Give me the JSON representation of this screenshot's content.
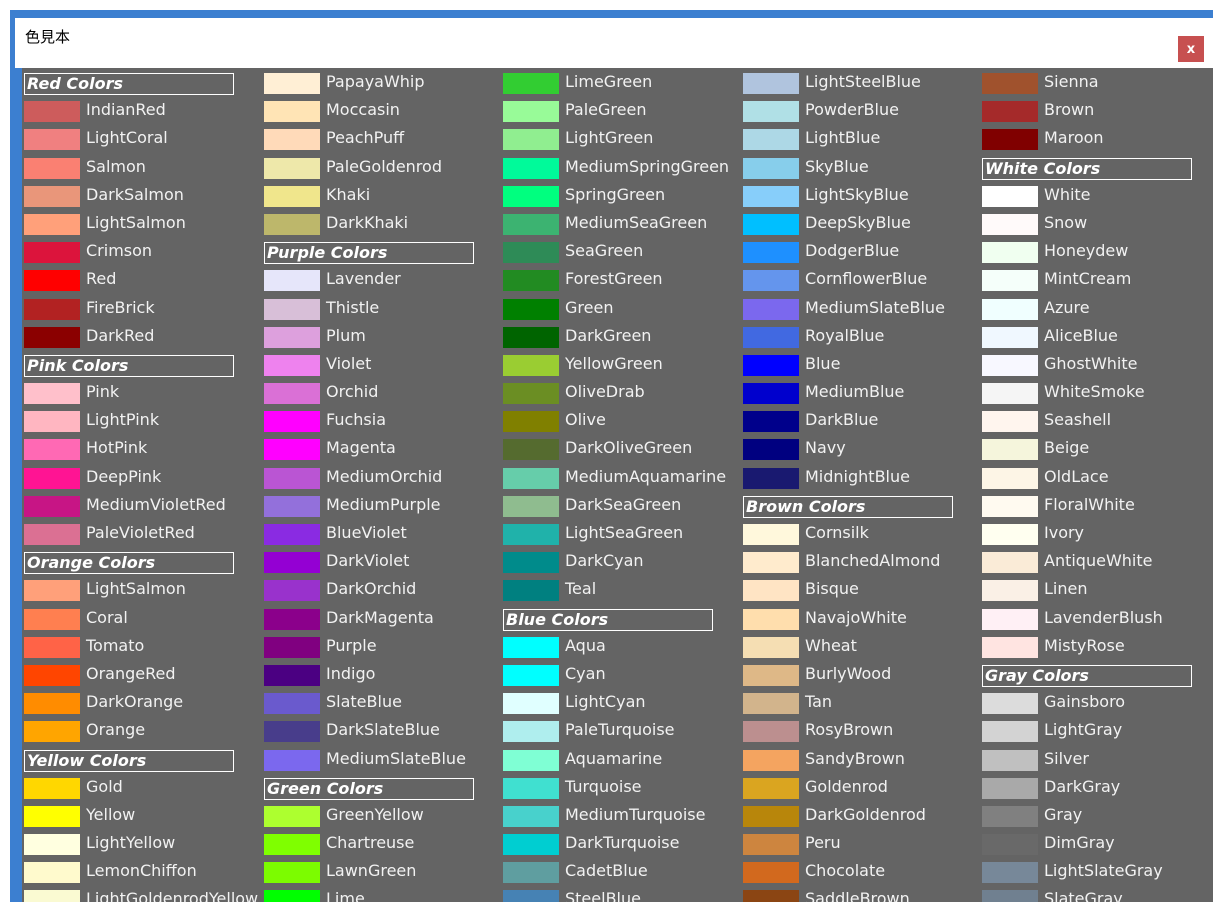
{
  "window": {
    "title": "色見本",
    "close_label": "x"
  },
  "columns": [
    [
      {
        "header": "Red Colors"
      },
      {
        "name": "IndianRed",
        "color": "#CD5C5C"
      },
      {
        "name": "LightCoral",
        "color": "#F08080"
      },
      {
        "name": "Salmon",
        "color": "#FA8072"
      },
      {
        "name": "DarkSalmon",
        "color": "#E9967A"
      },
      {
        "name": "LightSalmon",
        "color": "#FFA07A"
      },
      {
        "name": "Crimson",
        "color": "#DC143C"
      },
      {
        "name": "Red",
        "color": "#FF0000"
      },
      {
        "name": "FireBrick",
        "color": "#B22222"
      },
      {
        "name": "DarkRed",
        "color": "#8B0000"
      },
      {
        "header": "Pink Colors"
      },
      {
        "name": "Pink",
        "color": "#FFC0CB"
      },
      {
        "name": "LightPink",
        "color": "#FFB6C1"
      },
      {
        "name": "HotPink",
        "color": "#FF69B4"
      },
      {
        "name": "DeepPink",
        "color": "#FF1493"
      },
      {
        "name": "MediumVioletRed",
        "color": "#C71585"
      },
      {
        "name": "PaleVioletRed",
        "color": "#DB7093"
      },
      {
        "header": "Orange Colors"
      },
      {
        "name": "LightSalmon",
        "color": "#FFA07A"
      },
      {
        "name": "Coral",
        "color": "#FF7F50"
      },
      {
        "name": "Tomato",
        "color": "#FF6347"
      },
      {
        "name": "OrangeRed",
        "color": "#FF4500"
      },
      {
        "name": "DarkOrange",
        "color": "#FF8C00"
      },
      {
        "name": "Orange",
        "color": "#FFA500"
      },
      {
        "header": "Yellow Colors"
      },
      {
        "name": "Gold",
        "color": "#FFD700"
      },
      {
        "name": "Yellow",
        "color": "#FFFF00"
      },
      {
        "name": "LightYellow",
        "color": "#FFFFE0"
      },
      {
        "name": "LemonChiffon",
        "color": "#FFFACD"
      },
      {
        "name": "LightGoldenrodYellow",
        "color": "#FAFAD2"
      }
    ],
    [
      {
        "name": "PapayaWhip",
        "color": "#FFEFD5"
      },
      {
        "name": "Moccasin",
        "color": "#FFE4B5"
      },
      {
        "name": "PeachPuff",
        "color": "#FFDAB9"
      },
      {
        "name": "PaleGoldenrod",
        "color": "#EEE8AA"
      },
      {
        "name": "Khaki",
        "color": "#F0E68C"
      },
      {
        "name": "DarkKhaki",
        "color": "#BDB76B"
      },
      {
        "header": "Purple Colors"
      },
      {
        "name": "Lavender",
        "color": "#E6E6FA"
      },
      {
        "name": "Thistle",
        "color": "#D8BFD8"
      },
      {
        "name": "Plum",
        "color": "#DDA0DD"
      },
      {
        "name": "Violet",
        "color": "#EE82EE"
      },
      {
        "name": "Orchid",
        "color": "#DA70D6"
      },
      {
        "name": "Fuchsia",
        "color": "#FF00FF"
      },
      {
        "name": "Magenta",
        "color": "#FF00FF"
      },
      {
        "name": "MediumOrchid",
        "color": "#BA55D3"
      },
      {
        "name": "MediumPurple",
        "color": "#9370DB"
      },
      {
        "name": "BlueViolet",
        "color": "#8A2BE2"
      },
      {
        "name": "DarkViolet",
        "color": "#9400D3"
      },
      {
        "name": "DarkOrchid",
        "color": "#9932CC"
      },
      {
        "name": "DarkMagenta",
        "color": "#8B008B"
      },
      {
        "name": "Purple",
        "color": "#800080"
      },
      {
        "name": "Indigo",
        "color": "#4B0082"
      },
      {
        "name": "SlateBlue",
        "color": "#6A5ACD"
      },
      {
        "name": "DarkSlateBlue",
        "color": "#483D8B"
      },
      {
        "name": "MediumSlateBlue",
        "color": "#7B68EE"
      },
      {
        "header": "Green Colors"
      },
      {
        "name": "GreenYellow",
        "color": "#ADFF2F"
      },
      {
        "name": "Chartreuse",
        "color": "#7FFF00"
      },
      {
        "name": "LawnGreen",
        "color": "#7CFC00"
      },
      {
        "name": "Lime",
        "color": "#00FF00"
      }
    ],
    [
      {
        "name": "LimeGreen",
        "color": "#32CD32"
      },
      {
        "name": "PaleGreen",
        "color": "#98FB98"
      },
      {
        "name": "LightGreen",
        "color": "#90EE90"
      },
      {
        "name": "MediumSpringGreen",
        "color": "#00FA9A"
      },
      {
        "name": "SpringGreen",
        "color": "#00FF7F"
      },
      {
        "name": "MediumSeaGreen",
        "color": "#3CB371"
      },
      {
        "name": "SeaGreen",
        "color": "#2E8B57"
      },
      {
        "name": "ForestGreen",
        "color": "#228B22"
      },
      {
        "name": "Green",
        "color": "#008000"
      },
      {
        "name": "DarkGreen",
        "color": "#006400"
      },
      {
        "name": "YellowGreen",
        "color": "#9ACD32"
      },
      {
        "name": "OliveDrab",
        "color": "#6B8E23"
      },
      {
        "name": "Olive",
        "color": "#808000"
      },
      {
        "name": "DarkOliveGreen",
        "color": "#556B2F"
      },
      {
        "name": "MediumAquamarine",
        "color": "#66CDAA"
      },
      {
        "name": "DarkSeaGreen",
        "color": "#8FBC8F"
      },
      {
        "name": "LightSeaGreen",
        "color": "#20B2AA"
      },
      {
        "name": "DarkCyan",
        "color": "#008B8B"
      },
      {
        "name": "Teal",
        "color": "#008080"
      },
      {
        "header": "Blue Colors"
      },
      {
        "name": "Aqua",
        "color": "#00FFFF"
      },
      {
        "name": "Cyan",
        "color": "#00FFFF"
      },
      {
        "name": "LightCyan",
        "color": "#E0FFFF"
      },
      {
        "name": "PaleTurquoise",
        "color": "#AFEEEE"
      },
      {
        "name": "Aquamarine",
        "color": "#7FFFD4"
      },
      {
        "name": "Turquoise",
        "color": "#40E0D0"
      },
      {
        "name": "MediumTurquoise",
        "color": "#48D1CC"
      },
      {
        "name": "DarkTurquoise",
        "color": "#00CED1"
      },
      {
        "name": "CadetBlue",
        "color": "#5F9EA0"
      },
      {
        "name": "SteelBlue",
        "color": "#4682B4"
      }
    ],
    [
      {
        "name": "LightSteelBlue",
        "color": "#B0C4DE"
      },
      {
        "name": "PowderBlue",
        "color": "#B0E0E6"
      },
      {
        "name": "LightBlue",
        "color": "#ADD8E6"
      },
      {
        "name": "SkyBlue",
        "color": "#87CEEB"
      },
      {
        "name": "LightSkyBlue",
        "color": "#87CEFA"
      },
      {
        "name": "DeepSkyBlue",
        "color": "#00BFFF"
      },
      {
        "name": "DodgerBlue",
        "color": "#1E90FF"
      },
      {
        "name": "CornflowerBlue",
        "color": "#6495ED"
      },
      {
        "name": "MediumSlateBlue",
        "color": "#7B68EE"
      },
      {
        "name": "RoyalBlue",
        "color": "#4169E1"
      },
      {
        "name": "Blue",
        "color": "#0000FF"
      },
      {
        "name": "MediumBlue",
        "color": "#0000CD"
      },
      {
        "name": "DarkBlue",
        "color": "#00008B"
      },
      {
        "name": "Navy",
        "color": "#000080"
      },
      {
        "name": "MidnightBlue",
        "color": "#191970"
      },
      {
        "header": "Brown Colors"
      },
      {
        "name": "Cornsilk",
        "color": "#FFF8DC"
      },
      {
        "name": "BlanchedAlmond",
        "color": "#FFEBCD"
      },
      {
        "name": "Bisque",
        "color": "#FFE4C4"
      },
      {
        "name": "NavajoWhite",
        "color": "#FFDEAD"
      },
      {
        "name": "Wheat",
        "color": "#F5DEB3"
      },
      {
        "name": "BurlyWood",
        "color": "#DEB887"
      },
      {
        "name": "Tan",
        "color": "#D2B48C"
      },
      {
        "name": "RosyBrown",
        "color": "#BC8F8F"
      },
      {
        "name": "SandyBrown",
        "color": "#F4A460"
      },
      {
        "name": "Goldenrod",
        "color": "#DAA520"
      },
      {
        "name": "DarkGoldenrod",
        "color": "#B8860B"
      },
      {
        "name": "Peru",
        "color": "#CD853F"
      },
      {
        "name": "Chocolate",
        "color": "#D2691E"
      },
      {
        "name": "SaddleBrown",
        "color": "#8B4513"
      }
    ],
    [
      {
        "name": "Sienna",
        "color": "#A0522D"
      },
      {
        "name": "Brown",
        "color": "#A52A2A"
      },
      {
        "name": "Maroon",
        "color": "#800000"
      },
      {
        "header": "White Colors"
      },
      {
        "name": "White",
        "color": "#FFFFFF"
      },
      {
        "name": "Snow",
        "color": "#FFFAFA"
      },
      {
        "name": "Honeydew",
        "color": "#F0FFF0"
      },
      {
        "name": "MintCream",
        "color": "#F5FFFA"
      },
      {
        "name": "Azure",
        "color": "#F0FFFF"
      },
      {
        "name": "AliceBlue",
        "color": "#F0F8FF"
      },
      {
        "name": "GhostWhite",
        "color": "#F8F8FF"
      },
      {
        "name": "WhiteSmoke",
        "color": "#F5F5F5"
      },
      {
        "name": "Seashell",
        "color": "#FFF5EE"
      },
      {
        "name": "Beige",
        "color": "#F5F5DC"
      },
      {
        "name": "OldLace",
        "color": "#FDF5E6"
      },
      {
        "name": "FloralWhite",
        "color": "#FFFAF0"
      },
      {
        "name": "Ivory",
        "color": "#FFFFF0"
      },
      {
        "name": "AntiqueWhite",
        "color": "#FAEBD7"
      },
      {
        "name": "Linen",
        "color": "#FAF0E6"
      },
      {
        "name": "LavenderBlush",
        "color": "#FFF0F5"
      },
      {
        "name": "MistyRose",
        "color": "#FFE4E1"
      },
      {
        "header": "Gray Colors"
      },
      {
        "name": "Gainsboro",
        "color": "#DCDCDC"
      },
      {
        "name": "LightGray",
        "color": "#D3D3D3"
      },
      {
        "name": "Silver",
        "color": "#C0C0C0"
      },
      {
        "name": "DarkGray",
        "color": "#A9A9A9"
      },
      {
        "name": "Gray",
        "color": "#808080"
      },
      {
        "name": "DimGray",
        "color": "#696969"
      },
      {
        "name": "LightSlateGray",
        "color": "#778899"
      },
      {
        "name": "SlateGray",
        "color": "#708090"
      }
    ]
  ]
}
